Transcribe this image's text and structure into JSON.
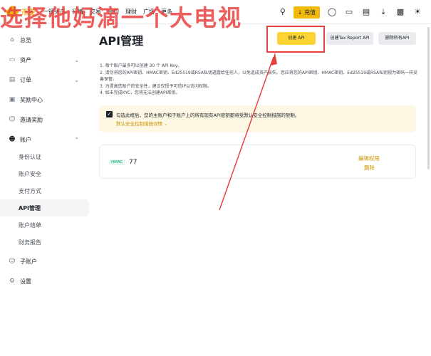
{
  "watermark": "选择他妈滴一个大电视",
  "nav": {
    "brand": "币安",
    "items": [
      "一键买币",
      "行情",
      "交易",
      "合约",
      "理财",
      "广场",
      "更多"
    ],
    "deposit_label": "充值"
  },
  "sidebar": {
    "items": [
      {
        "icon": "home-icon",
        "label": "总览"
      },
      {
        "icon": "wallet-icon",
        "label": "资产"
      },
      {
        "icon": "orders-icon",
        "label": "订单"
      },
      {
        "icon": "rewards-icon",
        "label": "奖励中心"
      },
      {
        "icon": "referral-icon",
        "label": "邀请奖励"
      },
      {
        "icon": "account-icon",
        "label": "账户"
      }
    ],
    "account_subitems": [
      "身份认证",
      "账户安全",
      "支付方式",
      "API管理",
      "账户结单",
      "财务报告"
    ],
    "bottom_items": [
      {
        "icon": "subaccount-icon",
        "label": "子账户"
      },
      {
        "icon": "settings-icon",
        "label": "设置"
      }
    ]
  },
  "main": {
    "title": "API管理",
    "buttons": {
      "create": "创建 API",
      "tax": "创建Tax Report API",
      "delete_all": "删除所有API"
    },
    "notes": [
      "1. 每个账户最多可以创建 30 个 API Key。",
      "2. 请勿将您的API密钥、HMAC密钥、Ed25519或RSA私钥透露给任何人，以免造成资产损失。您应将您的API密钥、HMAC密钥、Ed25519或RSA私钥视为密码一样妥善保管。",
      "3. 为提高您账户的安全性，建议仅授予可信IP以访问权限。",
      "4. 如未完成KYC，您将无法创建API密钥。"
    ],
    "notice": {
      "text": "勾选此框后，您的主账户和子账户上的所有现有API密钥都将受默认安全控制措施的限制。",
      "link": "默认安全控制措施详情"
    },
    "api_key": {
      "type_badge": "HMAC",
      "name": "77",
      "edit_label": "编辑权限",
      "delete_label": "删除"
    }
  }
}
